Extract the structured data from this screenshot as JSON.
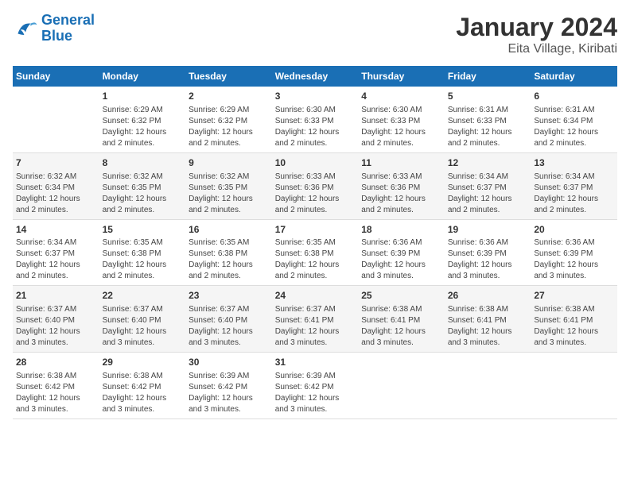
{
  "logo": {
    "line1": "General",
    "line2": "Blue"
  },
  "title": "January 2024",
  "subtitle": "Eita Village, Kiribati",
  "days_header": [
    "Sunday",
    "Monday",
    "Tuesday",
    "Wednesday",
    "Thursday",
    "Friday",
    "Saturday"
  ],
  "weeks": [
    [
      {
        "day": "",
        "info": ""
      },
      {
        "day": "1",
        "info": "Sunrise: 6:29 AM\nSunset: 6:32 PM\nDaylight: 12 hours\nand 2 minutes."
      },
      {
        "day": "2",
        "info": "Sunrise: 6:29 AM\nSunset: 6:32 PM\nDaylight: 12 hours\nand 2 minutes."
      },
      {
        "day": "3",
        "info": "Sunrise: 6:30 AM\nSunset: 6:33 PM\nDaylight: 12 hours\nand 2 minutes."
      },
      {
        "day": "4",
        "info": "Sunrise: 6:30 AM\nSunset: 6:33 PM\nDaylight: 12 hours\nand 2 minutes."
      },
      {
        "day": "5",
        "info": "Sunrise: 6:31 AM\nSunset: 6:33 PM\nDaylight: 12 hours\nand 2 minutes."
      },
      {
        "day": "6",
        "info": "Sunrise: 6:31 AM\nSunset: 6:34 PM\nDaylight: 12 hours\nand 2 minutes."
      }
    ],
    [
      {
        "day": "7",
        "info": "Sunrise: 6:32 AM\nSunset: 6:34 PM\nDaylight: 12 hours\nand 2 minutes."
      },
      {
        "day": "8",
        "info": "Sunrise: 6:32 AM\nSunset: 6:35 PM\nDaylight: 12 hours\nand 2 minutes."
      },
      {
        "day": "9",
        "info": "Sunrise: 6:32 AM\nSunset: 6:35 PM\nDaylight: 12 hours\nand 2 minutes."
      },
      {
        "day": "10",
        "info": "Sunrise: 6:33 AM\nSunset: 6:36 PM\nDaylight: 12 hours\nand 2 minutes."
      },
      {
        "day": "11",
        "info": "Sunrise: 6:33 AM\nSunset: 6:36 PM\nDaylight: 12 hours\nand 2 minutes."
      },
      {
        "day": "12",
        "info": "Sunrise: 6:34 AM\nSunset: 6:37 PM\nDaylight: 12 hours\nand 2 minutes."
      },
      {
        "day": "13",
        "info": "Sunrise: 6:34 AM\nSunset: 6:37 PM\nDaylight: 12 hours\nand 2 minutes."
      }
    ],
    [
      {
        "day": "14",
        "info": "Sunrise: 6:34 AM\nSunset: 6:37 PM\nDaylight: 12 hours\nand 2 minutes."
      },
      {
        "day": "15",
        "info": "Sunrise: 6:35 AM\nSunset: 6:38 PM\nDaylight: 12 hours\nand 2 minutes."
      },
      {
        "day": "16",
        "info": "Sunrise: 6:35 AM\nSunset: 6:38 PM\nDaylight: 12 hours\nand 2 minutes."
      },
      {
        "day": "17",
        "info": "Sunrise: 6:35 AM\nSunset: 6:38 PM\nDaylight: 12 hours\nand 2 minutes."
      },
      {
        "day": "18",
        "info": "Sunrise: 6:36 AM\nSunset: 6:39 PM\nDaylight: 12 hours\nand 3 minutes."
      },
      {
        "day": "19",
        "info": "Sunrise: 6:36 AM\nSunset: 6:39 PM\nDaylight: 12 hours\nand 3 minutes."
      },
      {
        "day": "20",
        "info": "Sunrise: 6:36 AM\nSunset: 6:39 PM\nDaylight: 12 hours\nand 3 minutes."
      }
    ],
    [
      {
        "day": "21",
        "info": "Sunrise: 6:37 AM\nSunset: 6:40 PM\nDaylight: 12 hours\nand 3 minutes."
      },
      {
        "day": "22",
        "info": "Sunrise: 6:37 AM\nSunset: 6:40 PM\nDaylight: 12 hours\nand 3 minutes."
      },
      {
        "day": "23",
        "info": "Sunrise: 6:37 AM\nSunset: 6:40 PM\nDaylight: 12 hours\nand 3 minutes."
      },
      {
        "day": "24",
        "info": "Sunrise: 6:37 AM\nSunset: 6:41 PM\nDaylight: 12 hours\nand 3 minutes."
      },
      {
        "day": "25",
        "info": "Sunrise: 6:38 AM\nSunset: 6:41 PM\nDaylight: 12 hours\nand 3 minutes."
      },
      {
        "day": "26",
        "info": "Sunrise: 6:38 AM\nSunset: 6:41 PM\nDaylight: 12 hours\nand 3 minutes."
      },
      {
        "day": "27",
        "info": "Sunrise: 6:38 AM\nSunset: 6:41 PM\nDaylight: 12 hours\nand 3 minutes."
      }
    ],
    [
      {
        "day": "28",
        "info": "Sunrise: 6:38 AM\nSunset: 6:42 PM\nDaylight: 12 hours\nand 3 minutes."
      },
      {
        "day": "29",
        "info": "Sunrise: 6:38 AM\nSunset: 6:42 PM\nDaylight: 12 hours\nand 3 minutes."
      },
      {
        "day": "30",
        "info": "Sunrise: 6:39 AM\nSunset: 6:42 PM\nDaylight: 12 hours\nand 3 minutes."
      },
      {
        "day": "31",
        "info": "Sunrise: 6:39 AM\nSunset: 6:42 PM\nDaylight: 12 hours\nand 3 minutes."
      },
      {
        "day": "",
        "info": ""
      },
      {
        "day": "",
        "info": ""
      },
      {
        "day": "",
        "info": ""
      }
    ]
  ]
}
